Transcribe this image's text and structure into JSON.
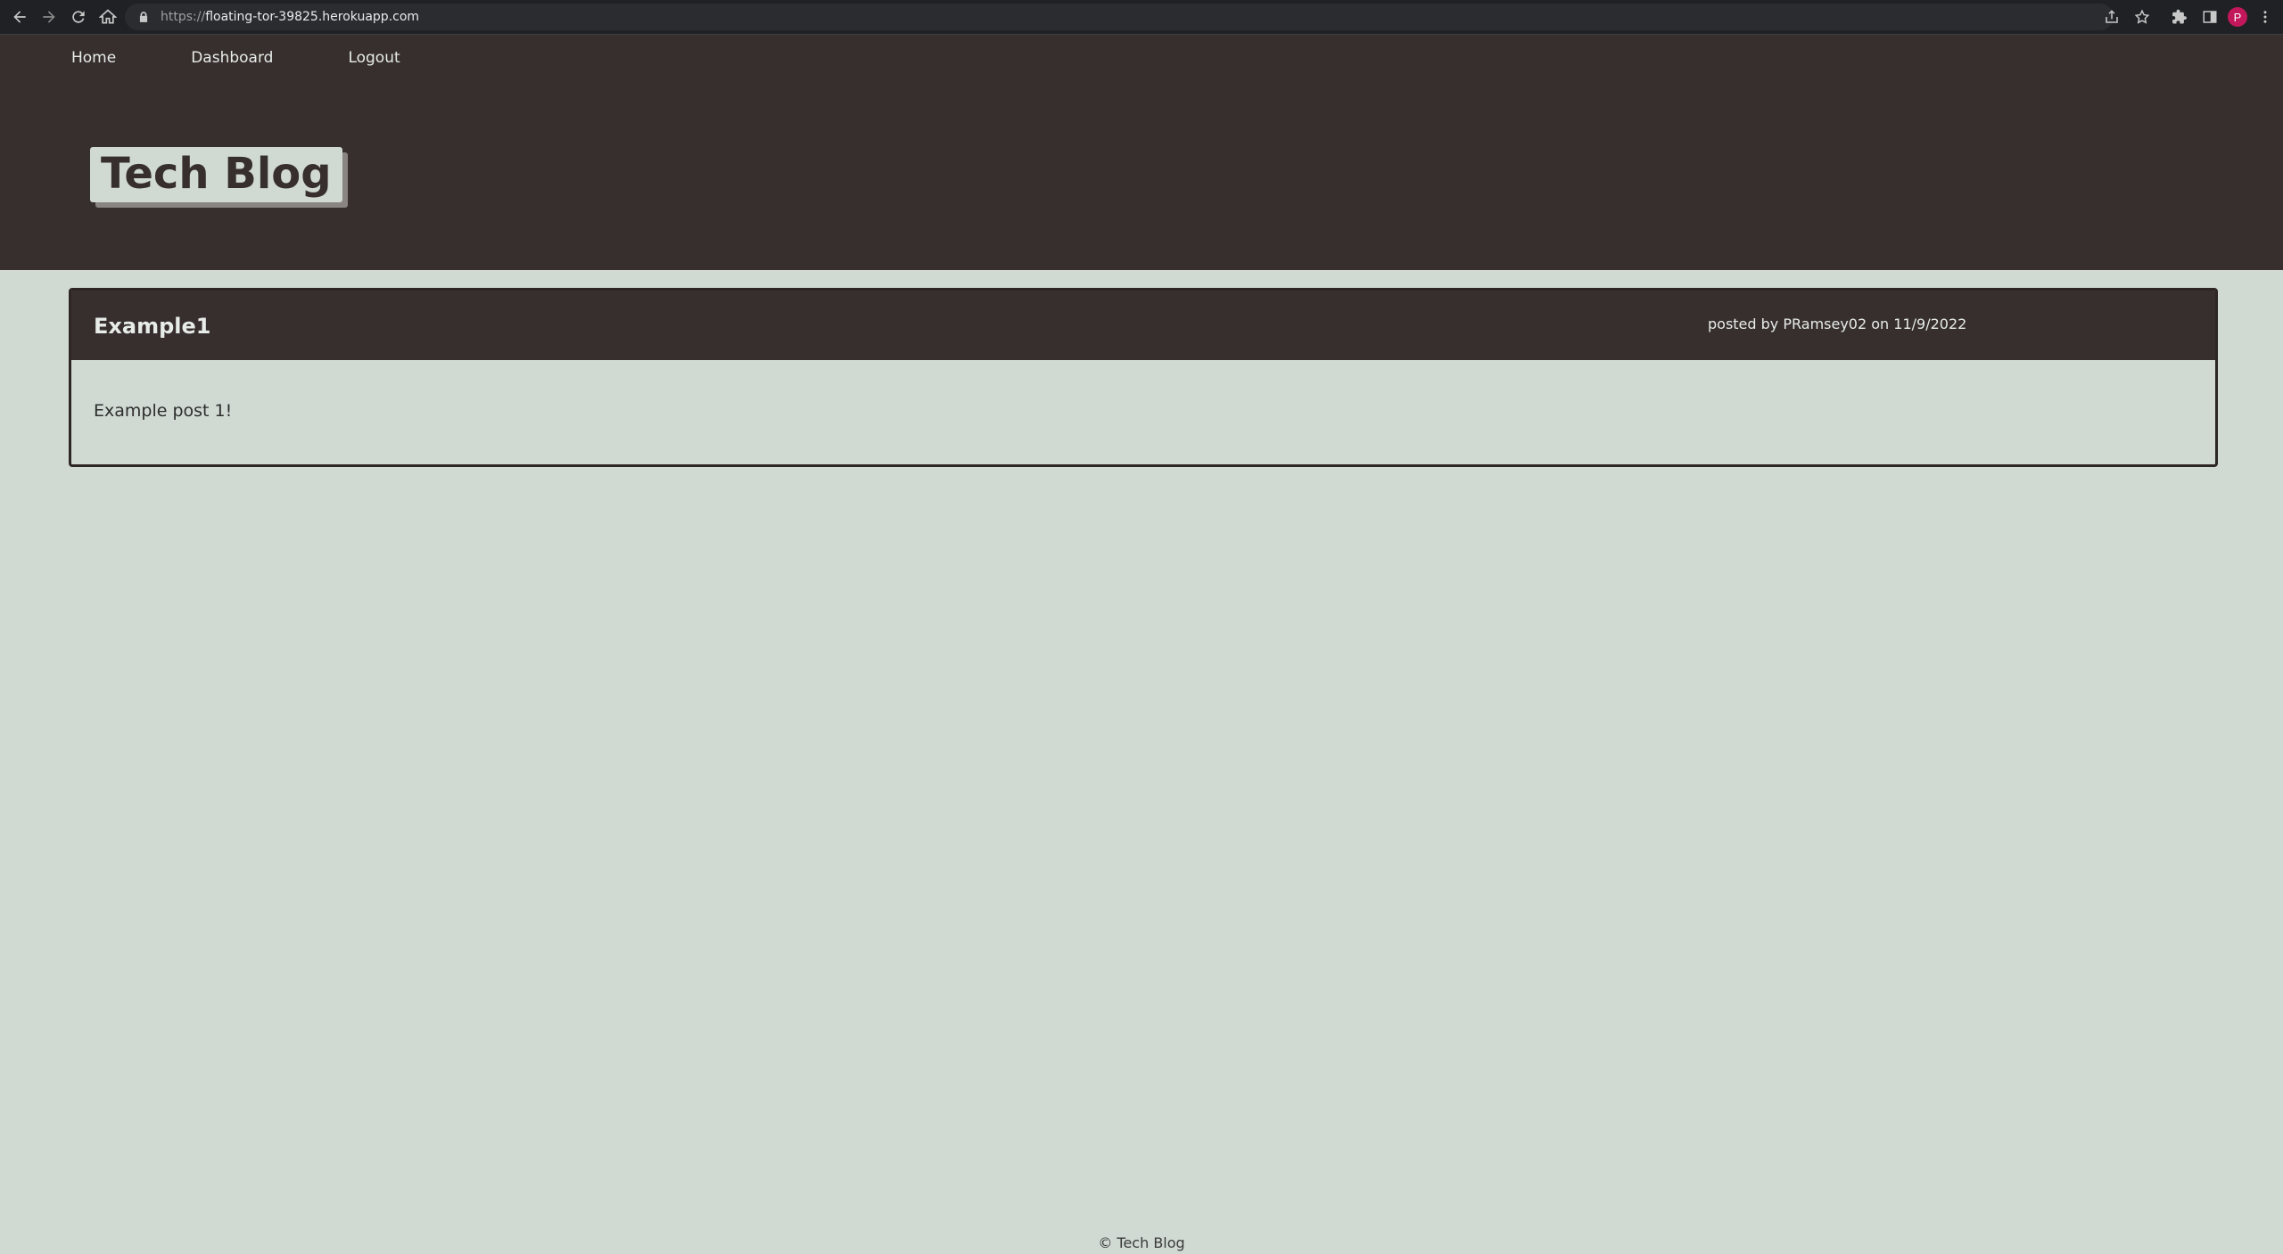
{
  "browser": {
    "url_prefix": "https://",
    "url_host": "floating-tor-39825.herokuapp.com",
    "profile_initial": "P"
  },
  "nav": {
    "home": "Home",
    "dashboard": "Dashboard",
    "logout": "Logout"
  },
  "site": {
    "logo": "Tech Blog"
  },
  "post": {
    "title": "Example1",
    "meta": "posted by PRamsey02 on 11/9/2022",
    "body": "Example post 1!"
  },
  "footer": {
    "text": "© Tech Blog"
  },
  "colors": {
    "header_bg": "#372f2d",
    "page_bg": "#d0dad2",
    "profile_avatar": "#c2185b"
  },
  "icons": [
    "back-icon",
    "forward-icon",
    "reload-icon",
    "home-icon",
    "lock-icon",
    "share-icon",
    "star-icon",
    "extensions-icon",
    "side-panel-icon",
    "menu-icon"
  ]
}
